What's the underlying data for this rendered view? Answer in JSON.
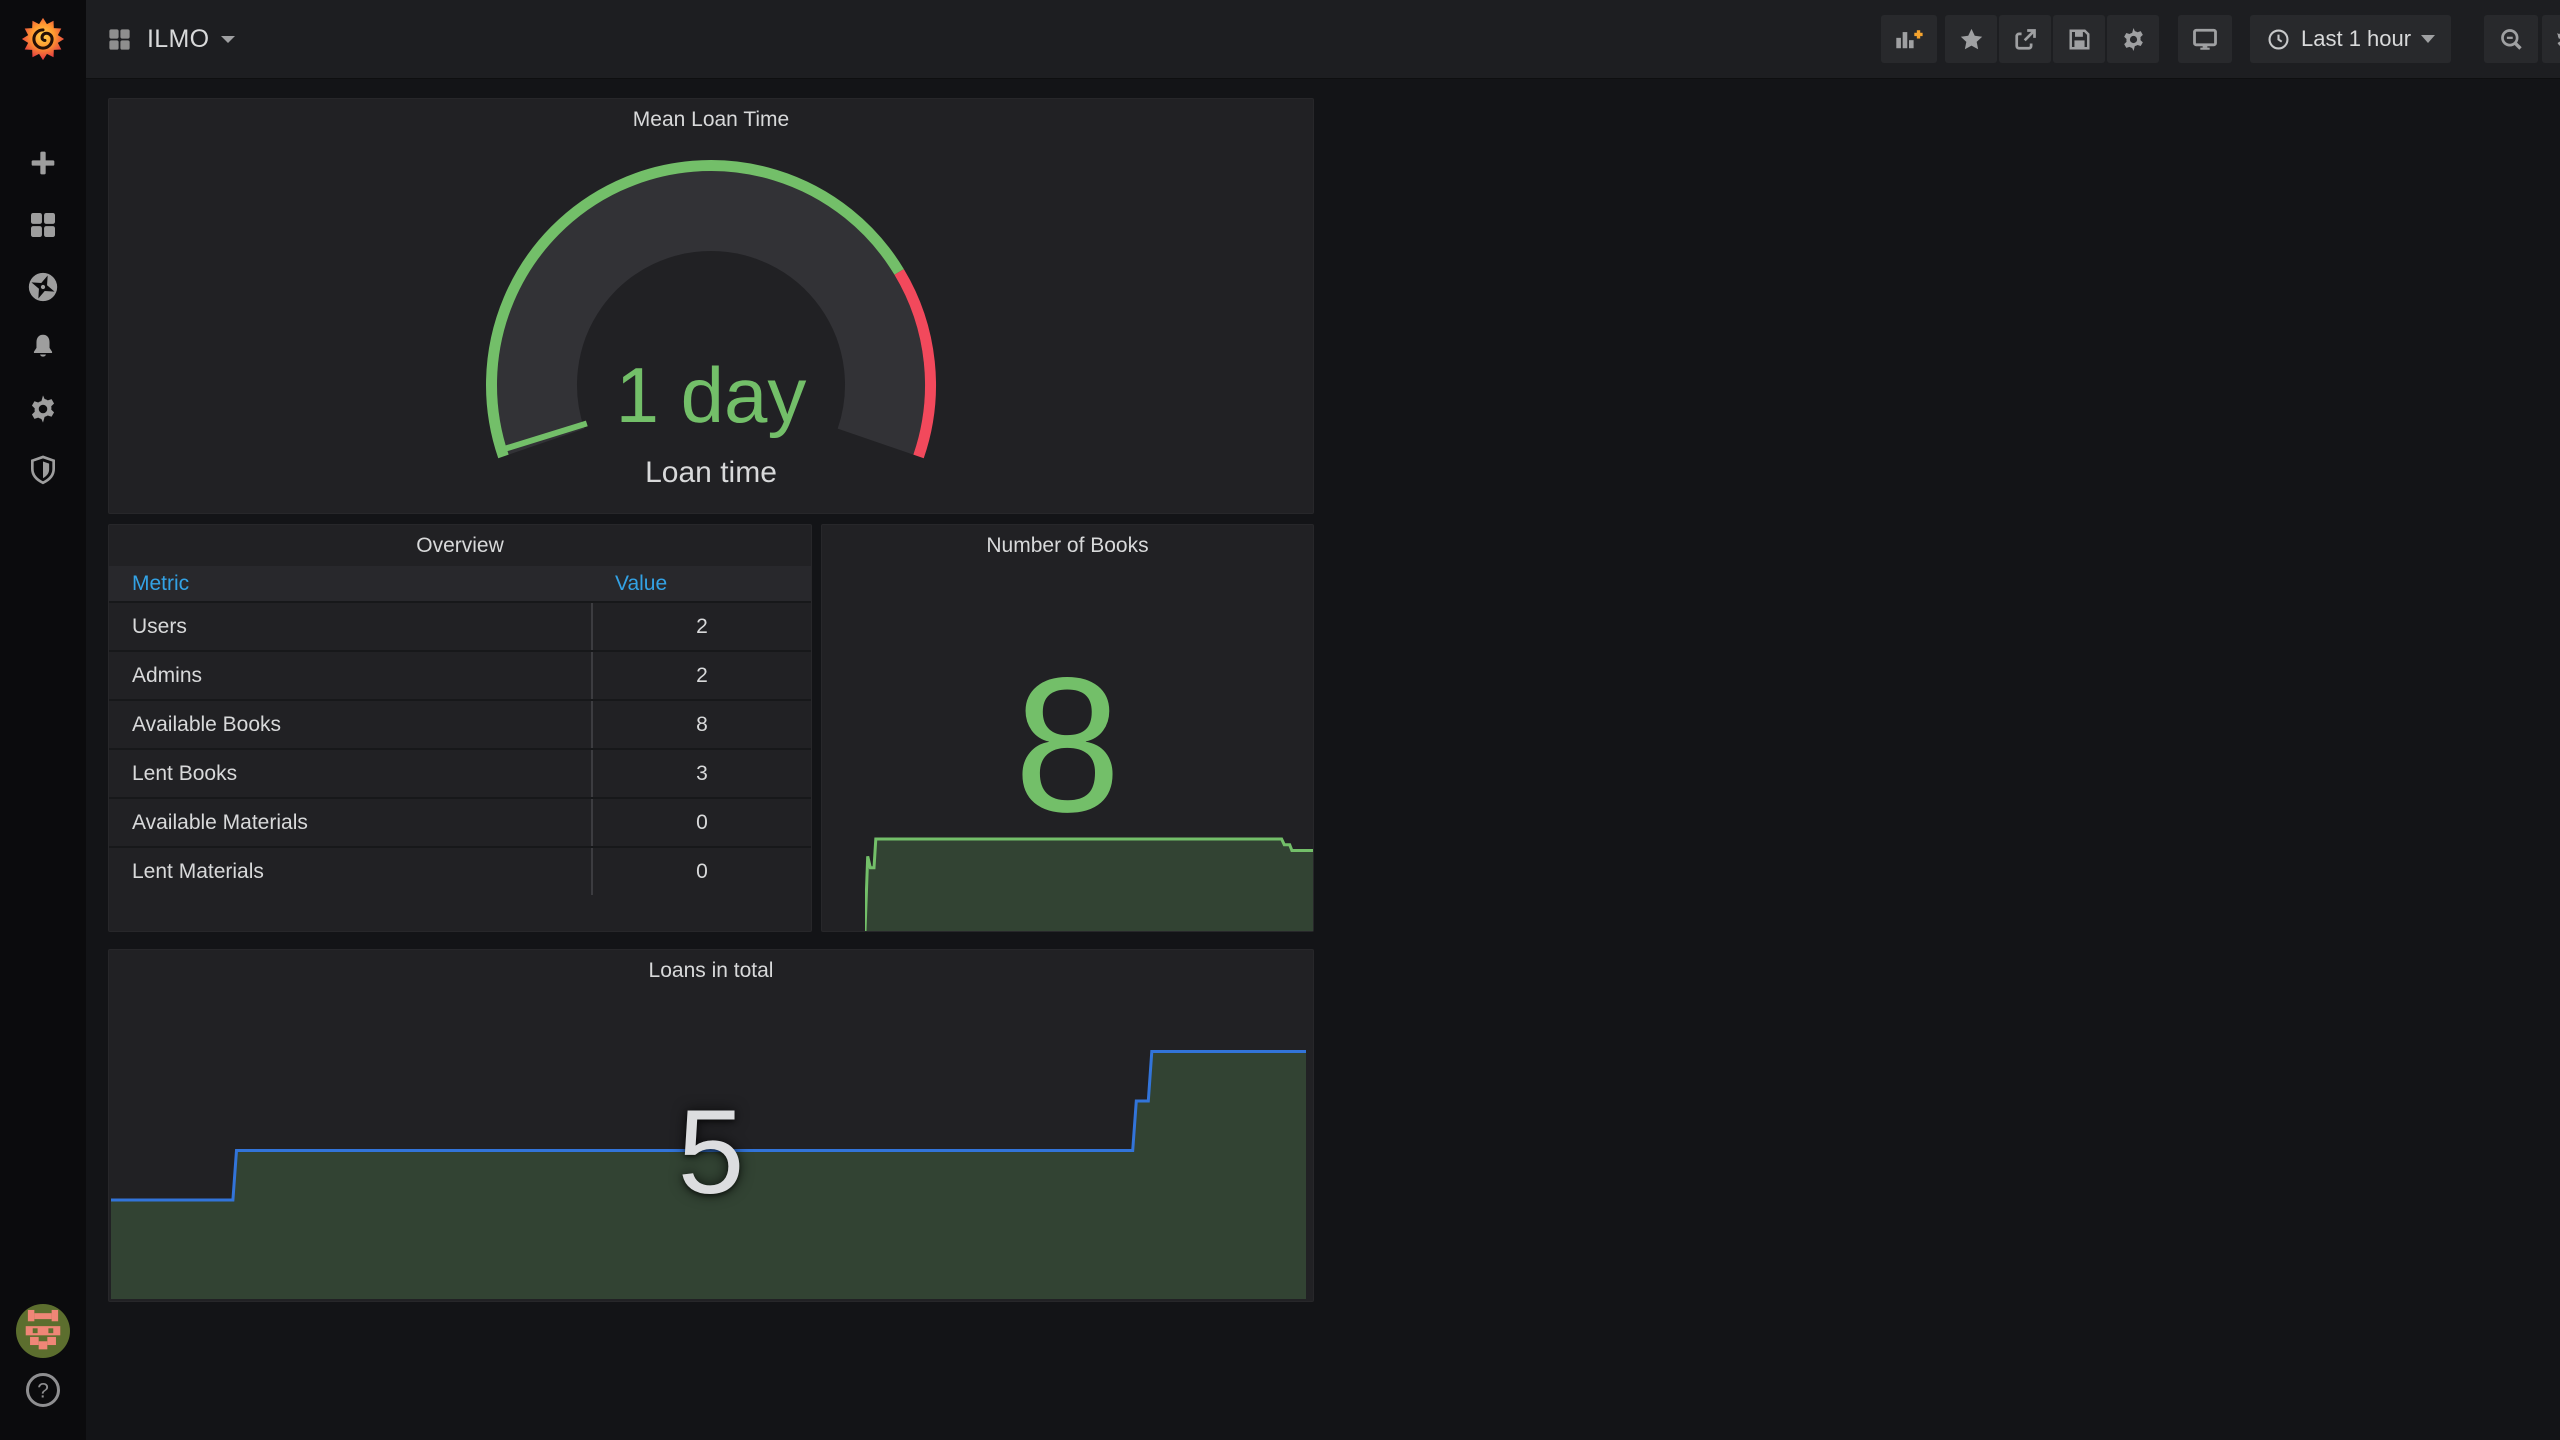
{
  "topbar": {
    "dashboard_title": "ILMO",
    "time_range_label": "Last 1 hour",
    "icons": [
      "grid-icon",
      "add-panel-icon",
      "star-icon",
      "share-icon",
      "save-icon",
      "gear-icon",
      "cycle-view-icon",
      "clock-icon",
      "zoom-out-icon",
      "refresh-icon"
    ]
  },
  "sidebar": {
    "items": [
      {
        "icon": "grafana-logo"
      },
      {
        "icon": "plus-icon"
      },
      {
        "icon": "dashboards-grid-icon"
      },
      {
        "icon": "explore-compass-icon"
      },
      {
        "icon": "alerting-bell-icon"
      },
      {
        "icon": "configuration-gear-icon"
      },
      {
        "icon": "server-admin-shield-icon"
      },
      {
        "icon": "user-avatar"
      },
      {
        "icon": "help-icon",
        "glyph": "?"
      }
    ]
  },
  "panels": {
    "gauge": {
      "title": "Mean Loan Time",
      "value": "1 day",
      "label": "Loan time"
    },
    "overview": {
      "title": "Overview",
      "columns": [
        "Metric",
        "Value"
      ],
      "rows": [
        [
          "Users",
          "2"
        ],
        [
          "Admins",
          "2"
        ],
        [
          "Available Books",
          "8"
        ],
        [
          "Lent Books",
          "3"
        ],
        [
          "Available Materials",
          "0"
        ],
        [
          "Lent Materials",
          "0"
        ]
      ]
    },
    "books": {
      "title": "Number of Books",
      "value": "8"
    },
    "loans": {
      "title": "Loans in total",
      "value": "5"
    }
  },
  "chart_data": [
    {
      "id": "mean-loan-time-gauge",
      "type": "gauge",
      "title": "Mean Loan Time",
      "value_text": "1 day",
      "field_label": "Loan time",
      "arc": {
        "start_angle": 199,
        "end_angle": -19,
        "red_start_angle": 31,
        "marker_angle": 197.2
      },
      "colors": {
        "value": "#73bf69",
        "green": "#73bf69",
        "red": "#f2495c",
        "track": "#323236"
      }
    },
    {
      "id": "number-of-books-sparkline",
      "type": "area",
      "title": "Number of Books",
      "current_value": 8,
      "sparkline": {
        "y_range": [
          0,
          8.7
        ],
        "points": [
          {
            "x": 0.0,
            "v": 0
          },
          {
            "x": 0.006,
            "v": 6.5
          },
          {
            "x": 0.012,
            "v": 5.5
          },
          {
            "x": 0.02,
            "v": 5.5
          },
          {
            "x": 0.024,
            "v": 8
          },
          {
            "x": 0.93,
            "v": 8
          },
          {
            "x": 0.936,
            "v": 7.5
          },
          {
            "x": 0.948,
            "v": 7.5
          },
          {
            "x": 0.953,
            "v": 7
          },
          {
            "x": 1.0,
            "v": 7
          }
        ],
        "line": "#73bf69",
        "fill": "rgba(115,191,105,0.22)"
      }
    },
    {
      "id": "loans-in-total-area",
      "type": "area",
      "title": "Loans in total",
      "current_value": 5,
      "series_values_estimated": [
        4,
        5,
        6,
        7
      ],
      "sparkline": {
        "y_range": [
          2,
          8.02
        ],
        "points": [
          {
            "x": 0.0,
            "v": 4
          },
          {
            "x": 0.102,
            "v": 4
          },
          {
            "x": 0.105,
            "v": 5
          },
          {
            "x": 0.855,
            "v": 5
          },
          {
            "x": 0.858,
            "v": 6
          },
          {
            "x": 0.868,
            "v": 6
          },
          {
            "x": 0.871,
            "v": 7
          },
          {
            "x": 1.0,
            "v": 7
          }
        ],
        "line": "#3274d9",
        "fill": "rgba(115,191,105,0.22)"
      }
    }
  ],
  "colors": {
    "green": "#73bf69",
    "red": "#f2495c",
    "table_header_blue": "#33a2e5",
    "line_blue": "#3274d9",
    "panel_bg": "#212124",
    "page_bg": "#131417"
  }
}
